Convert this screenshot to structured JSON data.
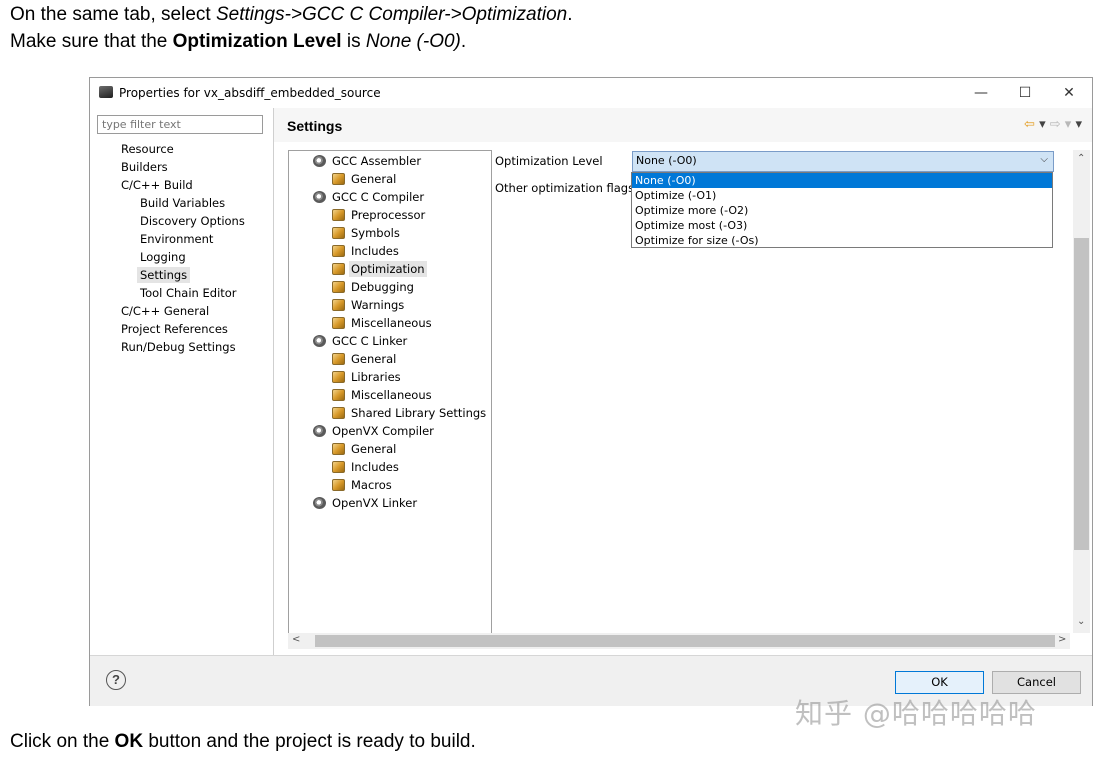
{
  "doc": {
    "line1": {
      "pre": "On the same tab, select ",
      "em": "Settings->GCC C Compiler->Optimization",
      "post": "."
    },
    "line2": {
      "pre": "Make sure that the ",
      "strong": "Optimization Level",
      "mid": " is ",
      "em": "None (-O0)",
      "post": "."
    },
    "line3": {
      "pre": "Click on the ",
      "strong": "OK",
      "post": " button and the project is ready to build."
    }
  },
  "window": {
    "title": "Properties for vx_absdiff_embedded_source",
    "controls": {
      "minimize": "—",
      "maximize": "☐",
      "close": "✕"
    }
  },
  "left_nav": {
    "filter_placeholder": "type filter text",
    "items": [
      "Resource",
      "Builders",
      "C/C++ Build",
      "Build Variables",
      "Discovery Options",
      "Environment",
      "Logging",
      "Settings",
      "Tool Chain Editor",
      "C/C++ General",
      "Project References",
      "Run/Debug Settings"
    ],
    "selected": "Settings"
  },
  "header": {
    "title": "Settings",
    "back_icon": "⇦",
    "forward_icon": "⇨",
    "menu_icon": "▾"
  },
  "tool_tree": {
    "items": [
      "GCC Assembler",
      "General",
      "GCC C Compiler",
      "Preprocessor",
      "Symbols",
      "Includes",
      "Optimization",
      "Debugging",
      "Warnings",
      "Miscellaneous",
      "GCC C Linker",
      "General",
      "Libraries",
      "Miscellaneous",
      "Shared Library Settings",
      "OpenVX Compiler",
      "General",
      "Includes",
      "Macros",
      "OpenVX Linker"
    ],
    "selected": "Optimization"
  },
  "options": {
    "optimization_level_label": "Optimization Level",
    "other_flags_label": "Other optimization flags",
    "selected_value": "None (-O0)",
    "dropdown": [
      "None (-O0)",
      "Optimize (-O1)",
      "Optimize more (-O2)",
      "Optimize most (-O3)",
      "Optimize for size (-Os)"
    ]
  },
  "footer": {
    "help_icon": "?",
    "ok_label": "OK",
    "cancel_label": "Cancel"
  },
  "watermark": "知乎 @哈哈哈哈哈",
  "colors": {
    "selection": "#0078d7",
    "nav_arrow": "#e39a1c",
    "combo_bg": "#cfe3f5"
  }
}
